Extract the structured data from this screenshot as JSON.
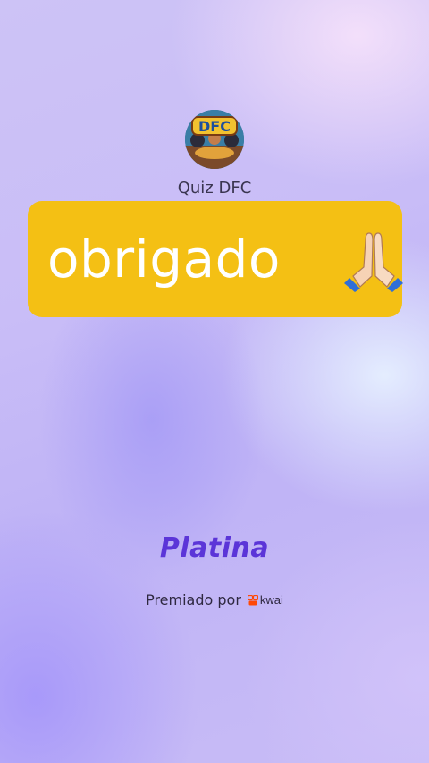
{
  "profile": {
    "avatar_text": "DFC",
    "name": "Quiz DFC"
  },
  "banner": {
    "text": "obrigado",
    "icon": "praying-hands-icon",
    "color": "#f4c014"
  },
  "award": {
    "tier": "Platina",
    "tier_color": "#5b35d8",
    "prefix": "Premiado por",
    "brand_word": "kwai",
    "brand_icon": "kwai-logo-icon",
    "brand_color": "#ff4906"
  }
}
